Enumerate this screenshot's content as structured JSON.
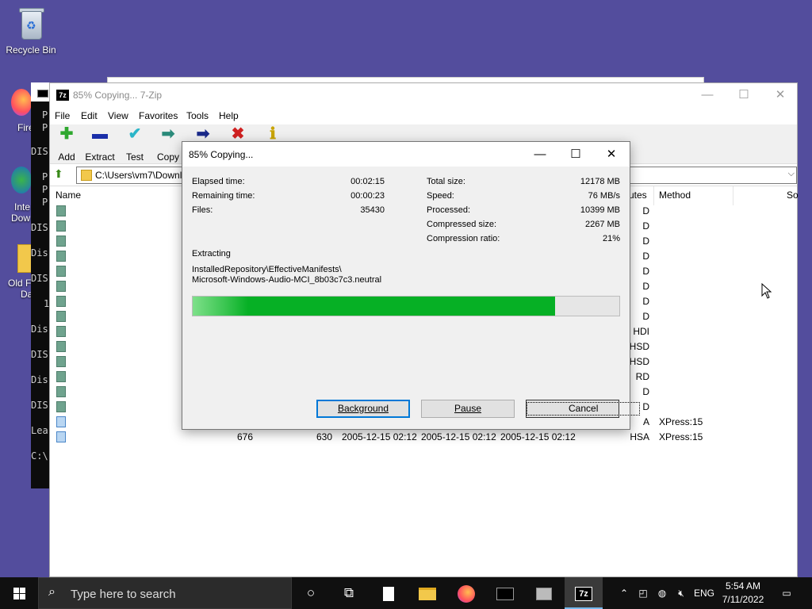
{
  "desktop": {
    "icons": [
      {
        "label": "Recycle Bin"
      }
    ],
    "partial_labels": [
      "Fire",
      "Inte",
      "Dow",
      "Old F",
      "Da"
    ]
  },
  "console": {
    "lines": [
      "P",
      "P",
      "DIS",
      "P",
      "P",
      "P",
      "DIS",
      "Dis",
      "DIS",
      "1",
      "Dis",
      "DIS",
      "Dis",
      "DIS",
      "Lea",
      "C:\\"
    ]
  },
  "main_window": {
    "title": "85% Copying... 7-Zip",
    "app_icon": "7z",
    "menu": [
      "File",
      "Edit",
      "View",
      "Favorites",
      "Tools",
      "Help"
    ],
    "toolbar": [
      {
        "label": "Add",
        "icon": "plus-icon",
        "glyph": "✚",
        "color": "#2fa82f"
      },
      {
        "label": "Extract",
        "icon": "minus-icon",
        "glyph": "▬",
        "color": "#1a2fa8"
      },
      {
        "label": "Test",
        "icon": "check-icon",
        "glyph": "✔",
        "color": "#2bb5c8"
      },
      {
        "label": "Copy",
        "icon": "copy-arrow-icon",
        "glyph": "➡",
        "color": "#2a8a7a"
      },
      {
        "label": "",
        "icon": "move-arrow-icon",
        "glyph": "➡",
        "color": "#1a2a8a"
      },
      {
        "label": "",
        "icon": "delete-icon",
        "glyph": "✖",
        "color": "#d02020"
      },
      {
        "label": "",
        "icon": "info-icon",
        "glyph": "ℹ",
        "color": "#c9a400"
      }
    ],
    "address": "C:\\Users\\vm7\\Downl",
    "columns": {
      "name": "Name",
      "attributes": "utes",
      "method": "Method",
      "solid": "So"
    },
    "rows": [
      {
        "size": "",
        "packed": "",
        "modified": "",
        "created": "",
        "accessed": "",
        "attr": "D",
        "method": "",
        "kind": "folder"
      },
      {
        "size": "",
        "packed": "",
        "modified": "",
        "created": "",
        "accessed": "",
        "attr": "D",
        "method": "",
        "kind": "folder"
      },
      {
        "size": "",
        "packed": "",
        "modified": "",
        "created": "",
        "accessed": "",
        "attr": "D",
        "method": "",
        "kind": "folder"
      },
      {
        "size": "",
        "packed": "",
        "modified": "",
        "created": "",
        "accessed": "",
        "attr": "D",
        "method": "",
        "kind": "folder"
      },
      {
        "size": "",
        "packed": "",
        "modified": "",
        "created": "",
        "accessed": "",
        "attr": "D",
        "method": "",
        "kind": "folder"
      },
      {
        "size": "",
        "packed": "",
        "modified": "",
        "created": "",
        "accessed": "",
        "attr": "D",
        "method": "",
        "kind": "folder"
      },
      {
        "size": "",
        "packed": "",
        "modified": "",
        "created": "",
        "accessed": "",
        "attr": "D",
        "method": "",
        "kind": "folder"
      },
      {
        "size": "",
        "packed": "",
        "modified": "",
        "created": "",
        "accessed": "",
        "attr": "D",
        "method": "",
        "kind": "folder"
      },
      {
        "size": "",
        "packed": "",
        "modified": "",
        "created": "",
        "accessed": "",
        "attr": "HDI",
        "method": "",
        "kind": "folder"
      },
      {
        "size": "",
        "packed": "",
        "modified": "",
        "created": "",
        "accessed": "",
        "attr": "HSD",
        "method": "",
        "kind": "folder"
      },
      {
        "size": "",
        "packed": "",
        "modified": "",
        "created": "",
        "accessed": "",
        "attr": "HSD",
        "method": "",
        "kind": "folder"
      },
      {
        "size": "",
        "packed": "",
        "modified": "",
        "created": "",
        "accessed": "",
        "attr": "RD",
        "method": "",
        "kind": "folder"
      },
      {
        "size": "",
        "packed": "",
        "modified": "",
        "created": "",
        "accessed": "",
        "attr": "D",
        "method": "",
        "kind": "folder"
      },
      {
        "size": "",
        "packed": "",
        "modified": "",
        "created": "",
        "accessed": "",
        "attr": "D",
        "method": "",
        "kind": "folder"
      },
      {
        "size": "",
        "packed": "",
        "modified": "",
        "created": "",
        "accessed": "",
        "attr": "A",
        "method": "XPress:15",
        "kind": "file"
      },
      {
        "size": "676",
        "packed": "630",
        "modified": "2005-12-15 02:12",
        "created": "2005-12-15 02:12",
        "accessed": "2005-12-15 02:12",
        "attr": "HSA",
        "method": "XPress:15",
        "kind": "file"
      }
    ]
  },
  "dialog": {
    "title": "85% Copying...",
    "elapsed_label": "Elapsed time:",
    "elapsed": "00:02:15",
    "remaining_label": "Remaining time:",
    "remaining": "00:00:23",
    "files_label": "Files:",
    "files": "35430",
    "total_label": "Total size:",
    "total": "12178 MB",
    "speed_label": "Speed:",
    "speed": "76 MB/s",
    "processed_label": "Processed:",
    "processed": "10399 MB",
    "compressed_label": "Compressed size:",
    "compressed": "2267 MB",
    "ratio_label": "Compression ratio:",
    "ratio": "21%",
    "operation": "Extracting",
    "path_line1": "InstalledRepository\\EffectiveManifests\\",
    "path_line2": "Microsoft-Windows-Audio-MCI_8b03c7c3.neutral",
    "progress": 0.85,
    "buttons": {
      "background": "Background",
      "pause": "Pause",
      "cancel": "Cancel"
    }
  },
  "taskbar": {
    "search_placeholder": "Type here to search",
    "language": "ENG",
    "time": "5:54 AM",
    "date": "7/11/2022"
  }
}
